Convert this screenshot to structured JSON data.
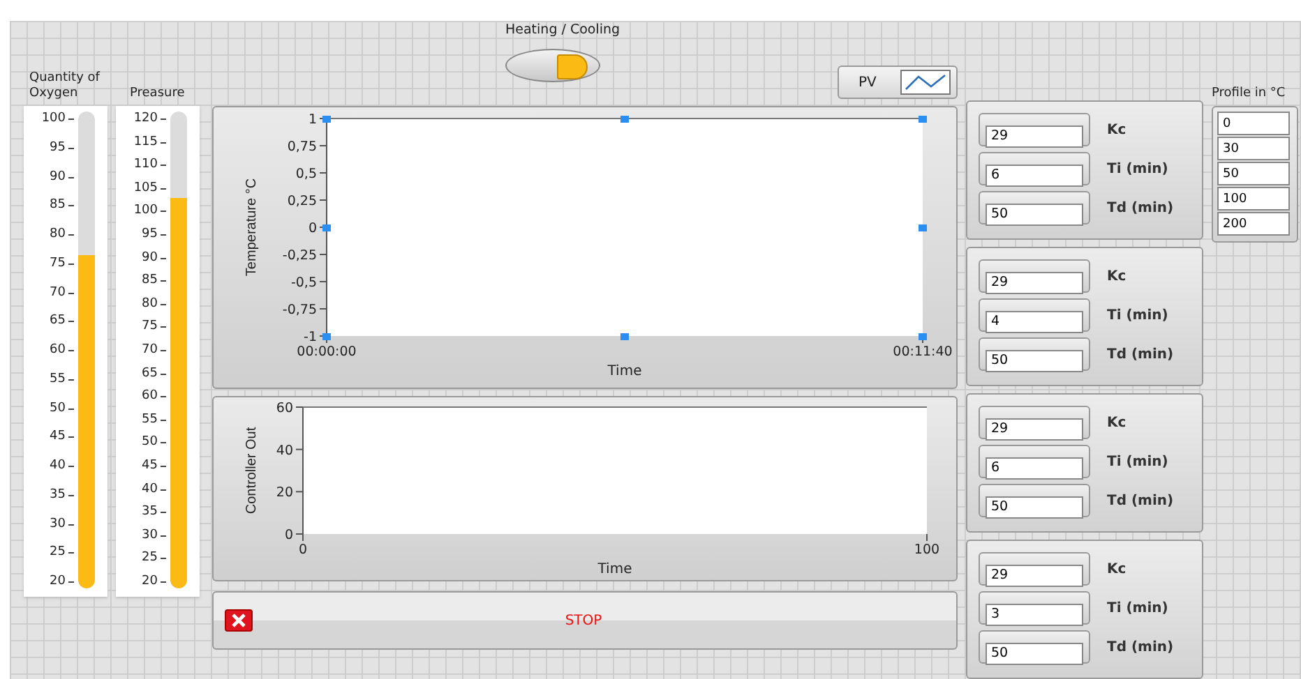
{
  "toggle": {
    "label": "Heating / Cooling",
    "on": true
  },
  "tanks": [
    {
      "label": "Quantity of Oxygen",
      "level": 0.7,
      "scale": [
        "100",
        "95",
        "90",
        "85",
        "80",
        "75",
        "70",
        "65",
        "60",
        "55",
        "50",
        "45",
        "40",
        "35",
        "30",
        "25",
        "20"
      ]
    },
    {
      "label": "Preasure",
      "level": 0.82,
      "scale": [
        "120",
        "115",
        "110",
        "105",
        "100",
        "95",
        "90",
        "85",
        "80",
        "75",
        "70",
        "65",
        "60",
        "55",
        "50",
        "45",
        "40",
        "35",
        "30",
        "25",
        "20"
      ]
    }
  ],
  "legend": {
    "label": "PV"
  },
  "charts": [
    {
      "selected": true,
      "chart_data": {
        "type": "line",
        "xlabel": "Time",
        "ylabel": "Temperature °C",
        "xlim": [
          0,
          700
        ],
        "ylim": [
          -1,
          1
        ],
        "xticks": [
          {
            "value": 0,
            "label": "00:00:00"
          },
          {
            "value": 700,
            "label": "00:11:40"
          }
        ],
        "yticks": [
          {
            "value": 1,
            "label": "1"
          },
          {
            "value": 0.75,
            "label": "0,75"
          },
          {
            "value": 0.5,
            "label": "0,5"
          },
          {
            "value": 0.25,
            "label": "0,25"
          },
          {
            "value": 0,
            "label": "0"
          },
          {
            "value": -0.25,
            "label": "-0,25"
          },
          {
            "value": -0.5,
            "label": "-0,5"
          },
          {
            "value": -0.75,
            "label": "-0,75"
          },
          {
            "value": -1,
            "label": "-1"
          }
        ]
      }
    },
    {
      "selected": false,
      "chart_data": {
        "type": "line",
        "xlabel": "Time",
        "ylabel": "Controller Out",
        "xlim": [
          0,
          100
        ],
        "ylim": [
          0,
          60
        ],
        "xticks": [
          {
            "value": 0,
            "label": "0"
          },
          {
            "value": 100,
            "label": "100"
          }
        ],
        "yticks": [
          {
            "value": 60,
            "label": "60"
          },
          {
            "value": 40,
            "label": "40"
          },
          {
            "value": 20,
            "label": "20"
          },
          {
            "value": 0,
            "label": "0"
          }
        ]
      }
    }
  ],
  "stop_button": {
    "label": "STOP"
  },
  "pid_groups": [
    {
      "fields": [
        {
          "value": "29",
          "label": "Kc"
        },
        {
          "value": "6",
          "label": "Ti (min)"
        },
        {
          "value": "50",
          "label": "Td (min)"
        }
      ]
    },
    {
      "fields": [
        {
          "value": "29",
          "label": "Kc"
        },
        {
          "value": "4",
          "label": "Ti (min)"
        },
        {
          "value": "50",
          "label": "Td (min)"
        }
      ]
    },
    {
      "fields": [
        {
          "value": "29",
          "label": "Kc"
        },
        {
          "value": "6",
          "label": "Ti (min)"
        },
        {
          "value": "50",
          "label": "Td (min)"
        }
      ]
    },
    {
      "fields": [
        {
          "value": "29",
          "label": "Kc"
        },
        {
          "value": "3",
          "label": "Ti (min)"
        },
        {
          "value": "50",
          "label": "Td (min)"
        }
      ]
    }
  ],
  "profile": {
    "label": "Profile in °C",
    "values": [
      "0",
      "30",
      "50",
      "100",
      "200"
    ]
  }
}
